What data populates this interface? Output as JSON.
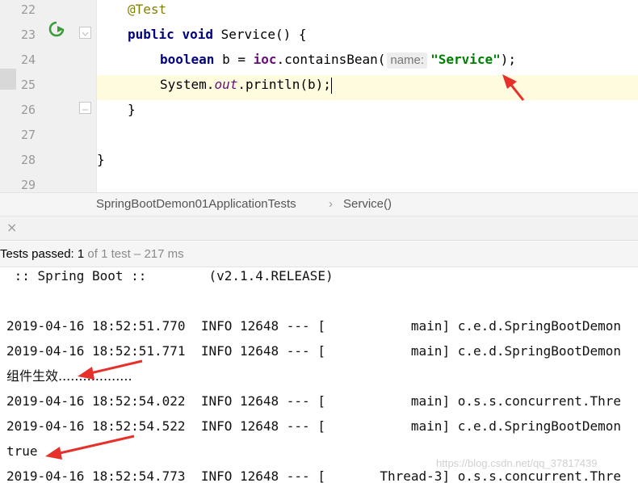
{
  "editor": {
    "lines": [
      {
        "num": "22"
      },
      {
        "num": "23"
      },
      {
        "num": "24"
      },
      {
        "num": "25"
      },
      {
        "num": "26"
      },
      {
        "num": "27"
      },
      {
        "num": "28"
      },
      {
        "num": "29"
      }
    ],
    "tokens": {
      "annotation": "@Test",
      "kw_public": "public",
      "kw_void": "void",
      "method_decl": " Service() {",
      "kw_boolean": "boolean",
      "assign": " b = ",
      "field_ioc": "ioc",
      "contains_call": ".containsBean(",
      "param_hint": "name:",
      "string_literal": "\"Service\"",
      "stmt_end": ");",
      "system": "System.",
      "field_out": "out",
      "println": ".println(b);",
      "close_brace_inner": "}",
      "close_brace_outer": "}"
    }
  },
  "breadcrumb": {
    "class_name": "SpringBootDemon01ApplicationTests",
    "separator": "›",
    "method": "Service()"
  },
  "run_panel": {
    "close_glyph": "×",
    "status_bold": "Tests passed: 1",
    "status_rest": " of 1 test – 217 ms"
  },
  "console": {
    "lines": [
      " :: Spring Boot ::        (v2.1.4.RELEASE)",
      "",
      "2019-04-16 18:52:51.770  INFO 12648 --- [           main] c.e.d.SpringBootDemon",
      "2019-04-16 18:52:51.771  INFO 12648 --- [           main] c.e.d.SpringBootDemon",
      "组件生效..................",
      "2019-04-16 18:52:54.022  INFO 12648 --- [           main] o.s.s.concurrent.Thre",
      "2019-04-16 18:52:54.522  INFO 12648 --- [           main] c.e.d.SpringBootDemon",
      "true",
      "2019-04-16 18:52:54.773  INFO 12648 --- [       Thread-3] o.s.s.concurrent.Thre"
    ]
  },
  "watermark": "https://blog.csdn.net/qq_37817439",
  "colors": {
    "keyword": "#000080",
    "annotation": "#808000",
    "string": "#008000",
    "field": "#660e7a",
    "arrow": "#e8302a",
    "current_line": "#fffbdf",
    "run_icon": "#3a9c3a"
  },
  "icons": [
    "run-test-icon",
    "fold-marker-icon",
    "close-icon",
    "red-arrow-annotation"
  ]
}
